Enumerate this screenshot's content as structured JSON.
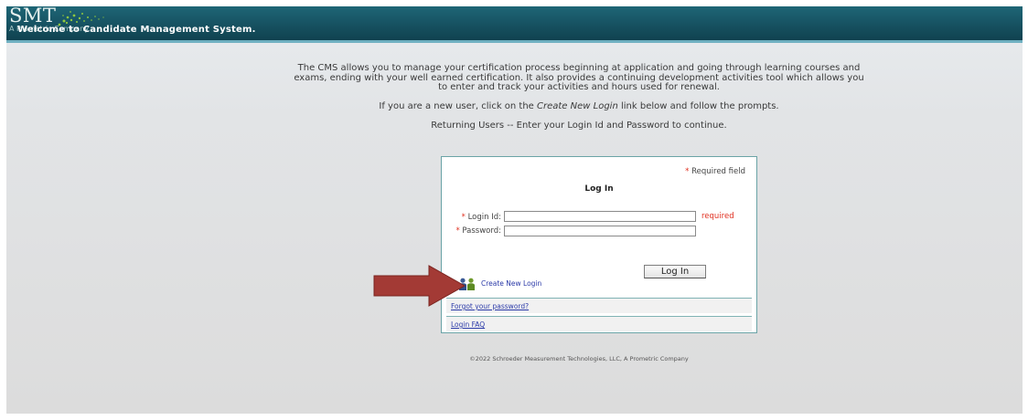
{
  "header": {
    "logo": "SMT",
    "logo_subtitle": "A Prometric\nCompany",
    "welcome": "Welcome to Candidate Management System."
  },
  "intro": {
    "paragraph1": "The CMS allows you to manage your certification process beginning at application and going through learning courses and exams, ending with your well earned certification. It also provides a continuing development activities tool which allows you to enter and track your activities and hours used for renewal.",
    "paragraph2_before": "If you are a new user, click on the ",
    "paragraph2_link": "Create New Login",
    "paragraph2_after": " link below and follow the prompts.",
    "paragraph3": "Returning Users -- Enter your Login Id and Password to continue."
  },
  "login_panel": {
    "required_asterisk": "*",
    "required_note": "Required field",
    "title": "Log In",
    "login_id_label": "Login Id:",
    "login_id_value": "",
    "login_id_required": "required",
    "password_label": "Password:",
    "password_value": "",
    "login_button": "Log In",
    "create_login": "Create New Login",
    "forgot_password": "Forgot your password?",
    "login_faq": "Login FAQ"
  },
  "footer": {
    "copyright": "©2022 Schroeder Measurement Technologies, LLC, A Prometric Company"
  },
  "colors": {
    "header_bg": "#154e5d",
    "link": "#2b3aa8",
    "required_red": "#e03020",
    "arrow": "#a33a35"
  }
}
